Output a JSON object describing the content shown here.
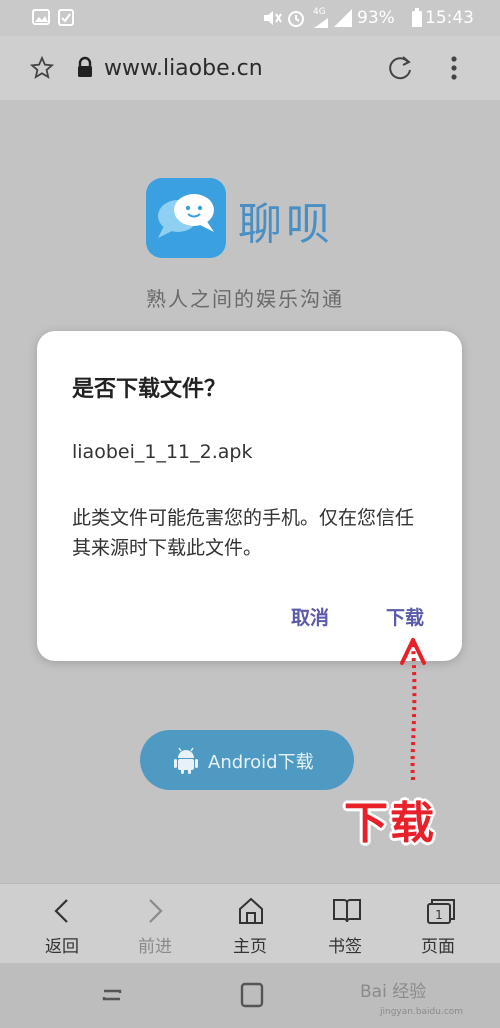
{
  "status_bar": {
    "battery": "93%",
    "time": "15:43",
    "network": "4G"
  },
  "url_bar": {
    "url": "www.liaobe.cn"
  },
  "page": {
    "brand_name": "聊呗",
    "slogan": "熟人之间的娱乐沟通",
    "download_button": "Android下载"
  },
  "dialog": {
    "title": "是否下载文件？",
    "filename": "liaobei_1_11_2.apk",
    "message": "此类文件可能危害您的手机。仅在您信任其来源时下载此文件。",
    "cancel_label": "取消",
    "confirm_label": "下载"
  },
  "annotation": {
    "text": "下载",
    "color": "#e8202a"
  },
  "bottom_nav": {
    "items": [
      {
        "label": "返回",
        "icon": "chevron-left-icon"
      },
      {
        "label": "前进",
        "icon": "chevron-right-icon"
      },
      {
        "label": "主页",
        "icon": "home-icon"
      },
      {
        "label": "书签",
        "icon": "book-icon"
      },
      {
        "label": "页面",
        "icon": "tabs-icon"
      }
    ],
    "tabs_count": "1"
  },
  "watermark": {
    "text": "Bai 经验",
    "sub": "jingyan.baidu.com"
  }
}
